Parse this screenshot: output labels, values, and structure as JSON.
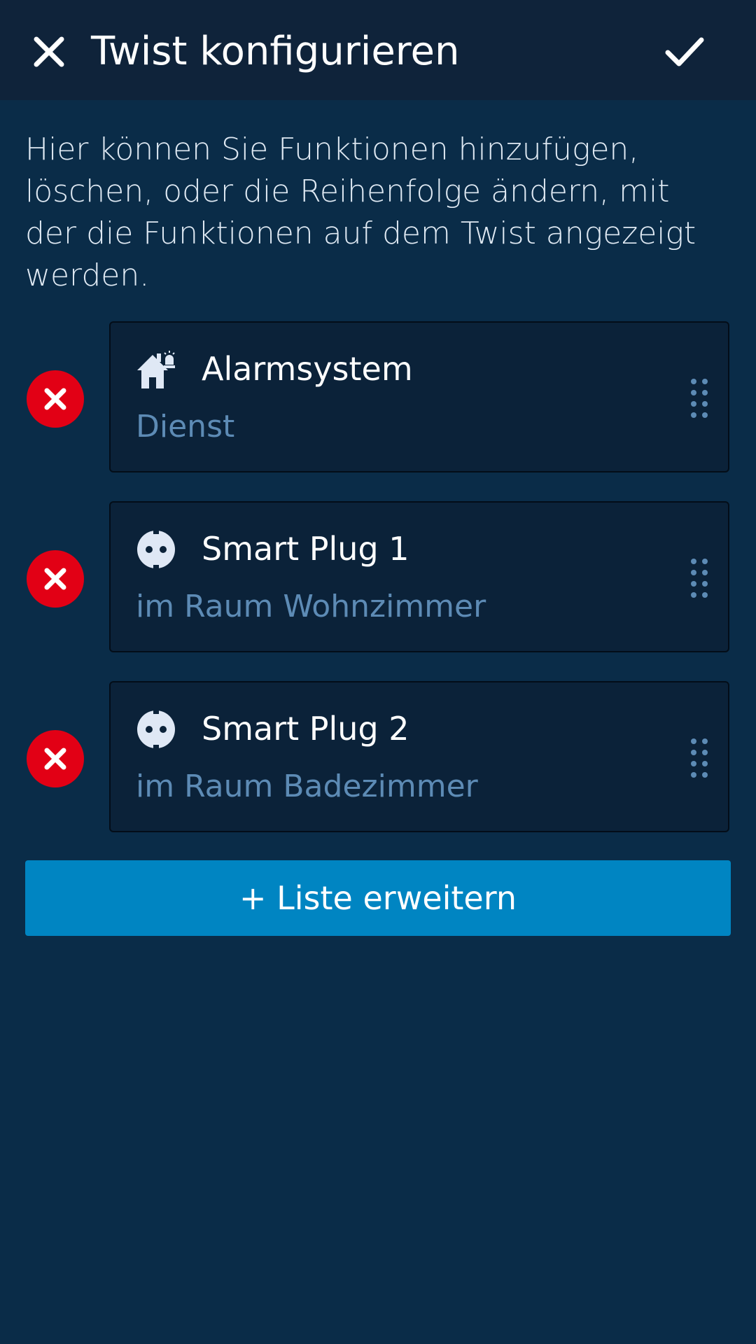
{
  "header": {
    "title": "Twist konfigurieren",
    "close_icon": "close-icon",
    "confirm_icon": "check-icon"
  },
  "description": "Hier können Sie Funktionen hinzufügen, löschen, oder die Reihenfolge ändern, mit der die Funktionen auf dem Twist angezeigt werden.",
  "items": [
    {
      "name": "Alarmsystem",
      "subtitle": "Dienst",
      "icon": "alarm-house-icon"
    },
    {
      "name": "Smart Plug 1",
      "subtitle": "im Raum Wohnzimmer",
      "icon": "plug-icon"
    },
    {
      "name": "Smart Plug 2",
      "subtitle": "im Raum Badezimmer",
      "icon": "plug-icon"
    }
  ],
  "add_button_label": "+ Liste erweitern",
  "colors": {
    "appbar": "#0f233a",
    "background": "#0a2c48",
    "card": "#0b2239",
    "remove": "#e20015",
    "accent": "#0085c2",
    "subtitle": "#5d8bb5"
  }
}
